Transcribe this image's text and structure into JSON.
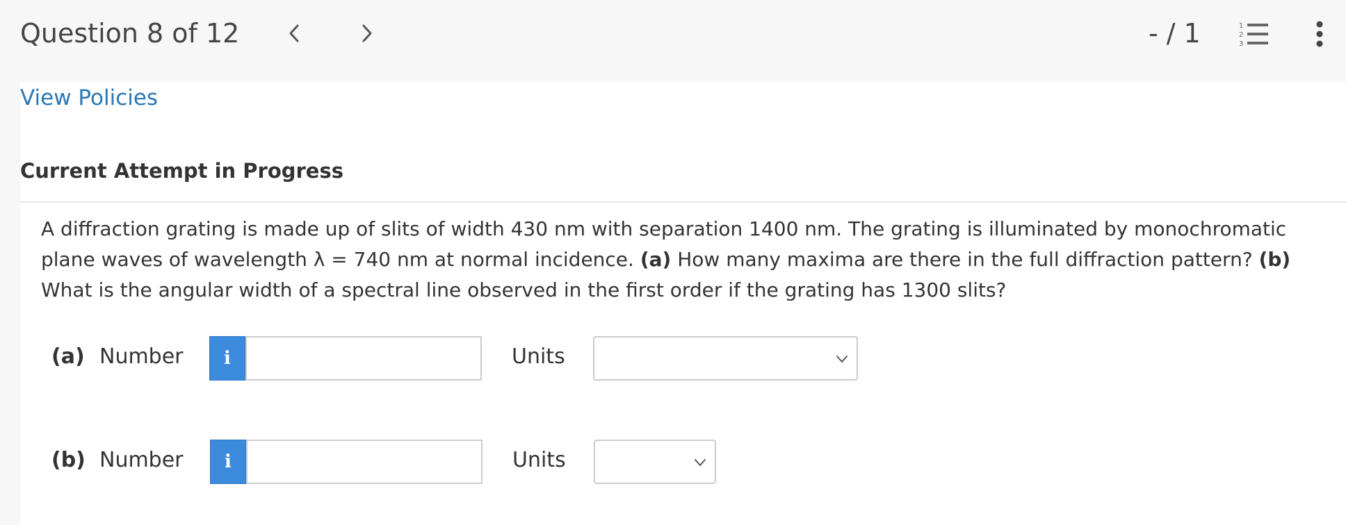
{
  "header": {
    "question_title": "Question 8 of 12",
    "score": "- / 1",
    "icons": {
      "prev": "chevron-left-icon",
      "next": "chevron-right-icon",
      "question_list": "numbered-list-icon",
      "more": "kebab-menu-icon"
    }
  },
  "policies": {
    "link_label": "View Policies"
  },
  "attempt": {
    "heading": "Current Attempt in Progress"
  },
  "question": {
    "intro": "A diffraction grating is made up of slits of width 430 nm with separation 1400 nm. The grating is illuminated by monochromatic plane waves of wavelength λ = 740 nm at normal incidence.",
    "part_a_label": "(a)",
    "part_a_text": "How many maxima are there in the full diffraction pattern?",
    "part_b_label": "(b)",
    "part_b_text": "What is the angular width of a spectral line observed in the first order if the grating has 1300 slits?"
  },
  "answers": [
    {
      "label": "(a)",
      "number_label": "Number",
      "info_glyph": "i",
      "value": "",
      "units_label": "Units",
      "units_selected": ""
    },
    {
      "label": "(b)",
      "number_label": "Number",
      "info_glyph": "i",
      "value": "",
      "units_label": "Units",
      "units_selected": ""
    }
  ],
  "colors": {
    "link": "#2a77b5",
    "info_button": "#3c8adc",
    "header_bg": "#f7f7f7"
  }
}
